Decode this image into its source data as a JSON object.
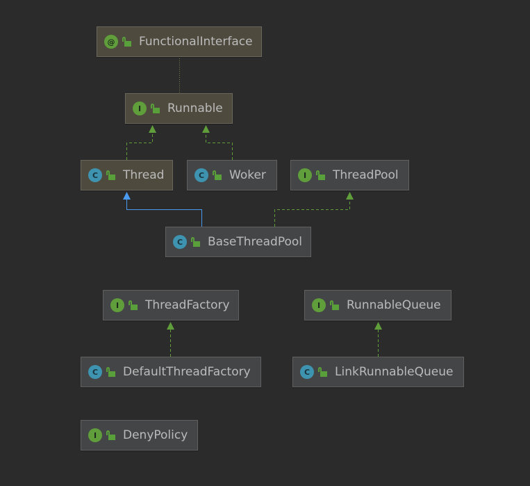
{
  "colors": {
    "background": "#2b2b2b",
    "interface_node": "#4e4a3e",
    "class_node": "#444547",
    "realization_edge": "#5f9e3a",
    "inheritance_edge": "#4a9bf0"
  },
  "nodes": [
    {
      "id": "functional",
      "name": "FunctionalInterface",
      "kind": "annotation",
      "badge": "@",
      "icon": "annotation-icon"
    },
    {
      "id": "runnable",
      "name": "Runnable",
      "kind": "interface",
      "badge": "I",
      "icon": "interface-icon"
    },
    {
      "id": "thread",
      "name": "Thread",
      "kind": "class",
      "badge": "C",
      "icon": "class-icon"
    },
    {
      "id": "woker",
      "name": "Woker",
      "kind": "class",
      "badge": "C",
      "icon": "class-icon"
    },
    {
      "id": "threadpool",
      "name": "ThreadPool",
      "kind": "interface",
      "badge": "I",
      "icon": "interface-icon"
    },
    {
      "id": "basethreadpool",
      "name": "BaseThreadPool",
      "kind": "class",
      "badge": "C",
      "icon": "class-icon"
    },
    {
      "id": "threadfactory",
      "name": "ThreadFactory",
      "kind": "interface",
      "badge": "I",
      "icon": "interface-icon"
    },
    {
      "id": "runnablequeue",
      "name": "RunnableQueue",
      "kind": "interface",
      "badge": "I",
      "icon": "interface-icon"
    },
    {
      "id": "defaultthreadfactory",
      "name": "DefaultThreadFactory",
      "kind": "class",
      "badge": "C",
      "icon": "class-icon"
    },
    {
      "id": "linkrunnablequeue",
      "name": "LinkRunnableQueue",
      "kind": "class",
      "badge": "C",
      "icon": "class-icon"
    },
    {
      "id": "denypolicy",
      "name": "DenyPolicy",
      "kind": "interface",
      "badge": "I",
      "icon": "interface-icon"
    }
  ],
  "edges": [
    {
      "from": "runnable",
      "to": "functional",
      "type": "annotated-by"
    },
    {
      "from": "thread",
      "to": "runnable",
      "type": "implements"
    },
    {
      "from": "woker",
      "to": "runnable",
      "type": "implements"
    },
    {
      "from": "basethreadpool",
      "to": "thread",
      "type": "extends"
    },
    {
      "from": "basethreadpool",
      "to": "threadpool",
      "type": "implements"
    },
    {
      "from": "defaultthreadfactory",
      "to": "threadfactory",
      "type": "implements"
    },
    {
      "from": "linkrunnablequeue",
      "to": "runnablequeue",
      "type": "implements"
    }
  ]
}
